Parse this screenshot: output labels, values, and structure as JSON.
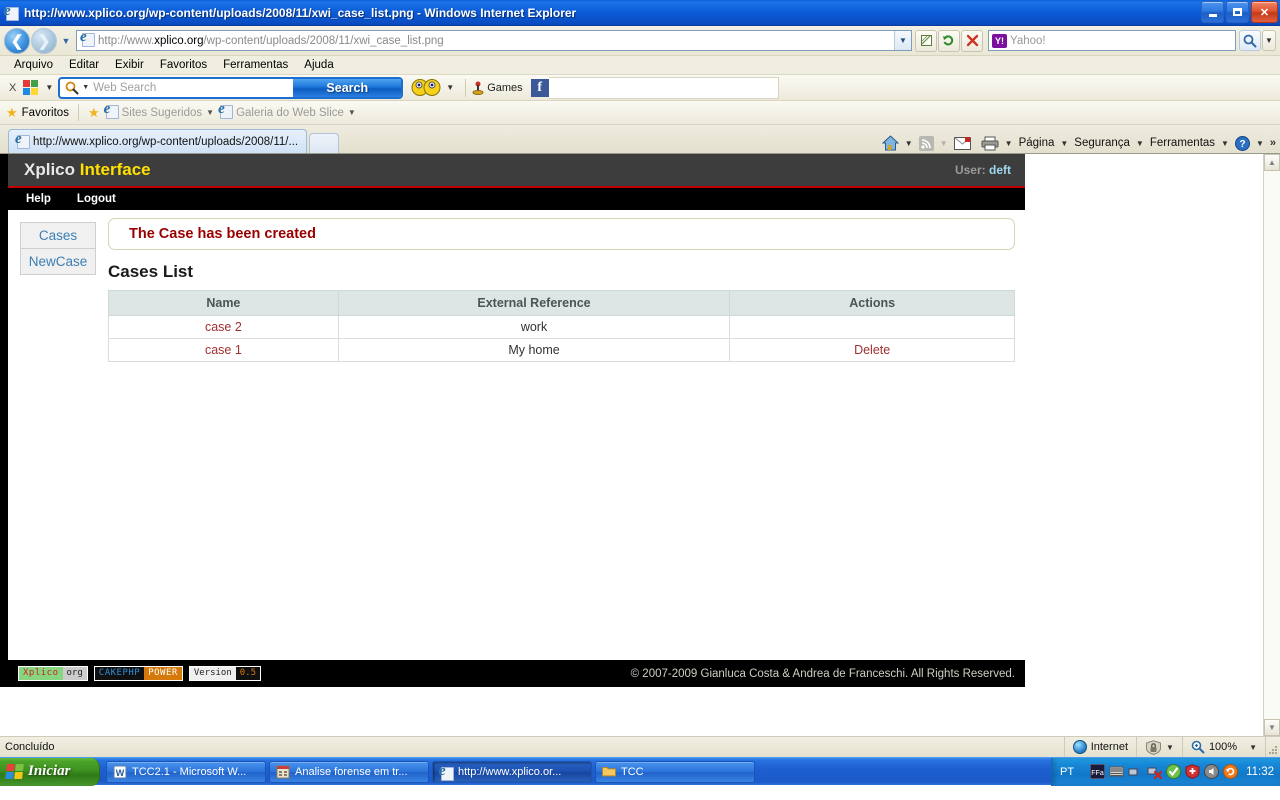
{
  "window": {
    "title": "http://www.xplico.org/wp-content/uploads/2008/11/xwi_case_list.png - Windows Internet Explorer",
    "minimize_label": "Minimize",
    "maximize_label": "Restore",
    "close_label": "Close"
  },
  "address_bar": {
    "url_prefix": "http://www.",
    "url_domain": "xplico.org",
    "url_suffix": "/wp-content/uploads/2008/11/xwi_case_list.png",
    "back_label": "Voltar",
    "forward_label": "Avançar",
    "recent_label": "Páginas recentes",
    "compat_label": "Modo de Exibição de Compatibilidade",
    "refresh_label": "Atualizar",
    "stop_label": "Parar",
    "search_provider": "Yahoo!",
    "search_placeholder": "Yahoo!",
    "search_go_label": "Pesquisar",
    "search_drop_label": "Opções de pesquisa"
  },
  "menu_bar": {
    "items": [
      "Arquivo",
      "Editar",
      "Exibir",
      "Favoritos",
      "Ferramentas",
      "Ajuda"
    ]
  },
  "yahoo_toolbar": {
    "close_label": "X",
    "logo_label": "Yahoo! Toolbar",
    "search_placeholder": "Web Search",
    "search_button": "Search",
    "messenger_label": "Messenger",
    "games_label": "Games",
    "facebook_label": "f"
  },
  "favorites_bar": {
    "favorites_label": "Favoritos",
    "add_label": "Adicionar a Favoritos",
    "suggested_sites": "Sites Sugeridos",
    "web_slice_gallery": "Galeria do Web Slice"
  },
  "tabs": {
    "items": [
      {
        "label": "http://www.xplico.org/wp-content/uploads/2008/11/..."
      }
    ],
    "new_tab_label": "Nova Guia"
  },
  "command_bar": {
    "home_label": "Home",
    "feeds_label": "Feeds",
    "mail_label": "Ler Email",
    "print_label": "Imprimir",
    "items": [
      "Página",
      "Segurança",
      "Ferramentas"
    ],
    "help_label": "?",
    "overflow_label": "»"
  },
  "xplico": {
    "brand_first": "Xplico",
    "brand_second": "Interface",
    "user_label": "User:",
    "user_name": "deft",
    "menu": [
      "Help",
      "Logout"
    ],
    "sidebar": [
      "Cases",
      "NewCase"
    ],
    "flash_message": "The Case has been created",
    "page_title": "Cases List",
    "table": {
      "columns": [
        "Name",
        "External Reference",
        "Actions"
      ],
      "rows": [
        {
          "name": "case 2",
          "external_reference": "work",
          "action": ""
        },
        {
          "name": "case 1",
          "external_reference": "My home",
          "action": "Delete"
        }
      ]
    },
    "footer": {
      "badge_xplico_left": "Xplico",
      "badge_xplico_right": "org",
      "badge_cake_left": "CAKEPHP",
      "badge_cake_right": "POWER",
      "badge_version_left": "Version",
      "badge_version_right": "0.5",
      "copyright": "© 2007-2009 Gianluca Costa & Andrea de Franceschi. All Rights Reserved."
    }
  },
  "status_bar": {
    "message": "Concluído",
    "zone": "Internet",
    "protected_mode_label": "Modo Protegido",
    "zoom": "100%"
  },
  "taskbar": {
    "start_label": "Iniciar",
    "items": [
      {
        "label": "TCC2.1 - Microsoft W...",
        "active": false
      },
      {
        "label": "Analise forense em tr...",
        "active": false
      },
      {
        "label": "http://www.xplico.or...",
        "active": true
      },
      {
        "label": "TCC",
        "active": false
      }
    ],
    "language": "PT",
    "clock": "11:32"
  }
}
